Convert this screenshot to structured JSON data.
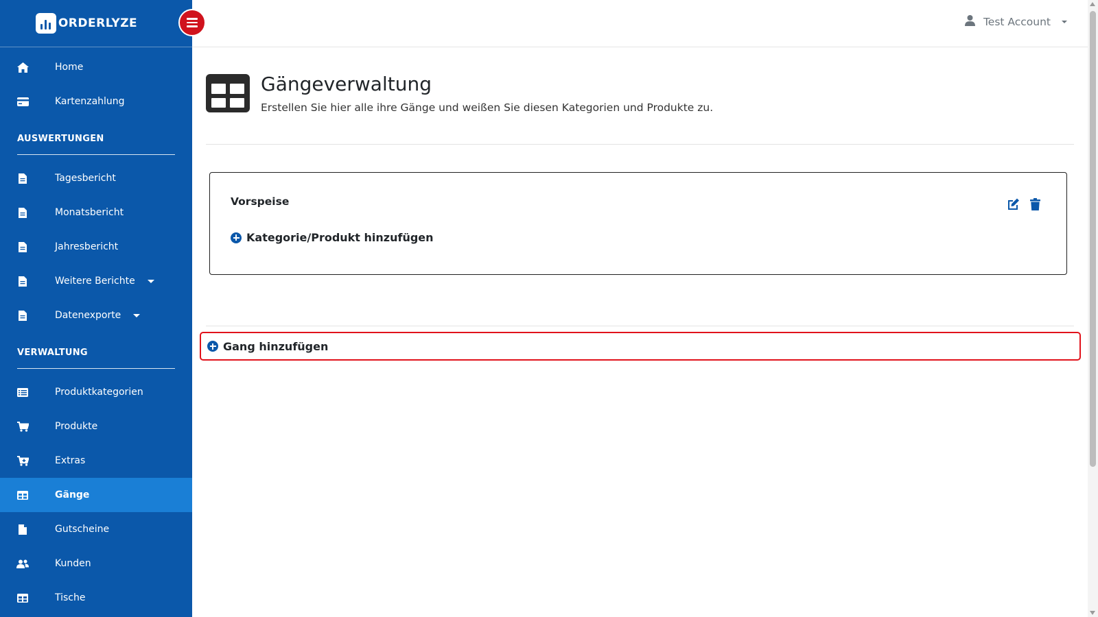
{
  "brand": {
    "name": "ORDERLYZE"
  },
  "topbar": {
    "account_label": "Test Account"
  },
  "sidebar": {
    "items_top": [
      {
        "label": "Home",
        "icon": "home-icon"
      },
      {
        "label": "Kartenzahlung",
        "icon": "credit-card-icon"
      }
    ],
    "section_auswertungen": "AUSWERTUNGEN",
    "items_auswertungen": [
      {
        "label": "Tagesbericht",
        "icon": "file-icon"
      },
      {
        "label": "Monatsbericht",
        "icon": "file-icon"
      },
      {
        "label": "Jahresbericht",
        "icon": "file-icon"
      },
      {
        "label": "Weitere Berichte",
        "icon": "file-icon"
      },
      {
        "label": "Datenexporte",
        "icon": "file-icon"
      }
    ],
    "section_verwaltung": "VERWALTUNG",
    "items_verwaltung": [
      {
        "label": "Produktkategorien",
        "icon": "list-icon"
      },
      {
        "label": "Produkte",
        "icon": "cart-icon"
      },
      {
        "label": "Extras",
        "icon": "cart-plus-icon"
      },
      {
        "label": "Gänge",
        "icon": "table-icon",
        "active": true
      },
      {
        "label": "Gutscheine",
        "icon": "document-icon"
      },
      {
        "label": "Kunden",
        "icon": "users-icon"
      },
      {
        "label": "Tische",
        "icon": "table-icon"
      }
    ]
  },
  "main": {
    "title": "Gängeverwaltung",
    "subtitle": "Erstellen Sie hier alle ihre Gänge und weißen Sie diesen Kategorien und Produkte zu.",
    "gang": {
      "name": "Vorspeise",
      "add_category_label": "Kategorie/Produkt hinzufügen"
    },
    "add_gang_label": "Gang hinzufügen"
  },
  "colors": {
    "sidebar_bg": "#0b58aa",
    "sidebar_active": "#1a7fd6",
    "accent_red": "#d0131d",
    "highlight_border": "#e1121b"
  }
}
